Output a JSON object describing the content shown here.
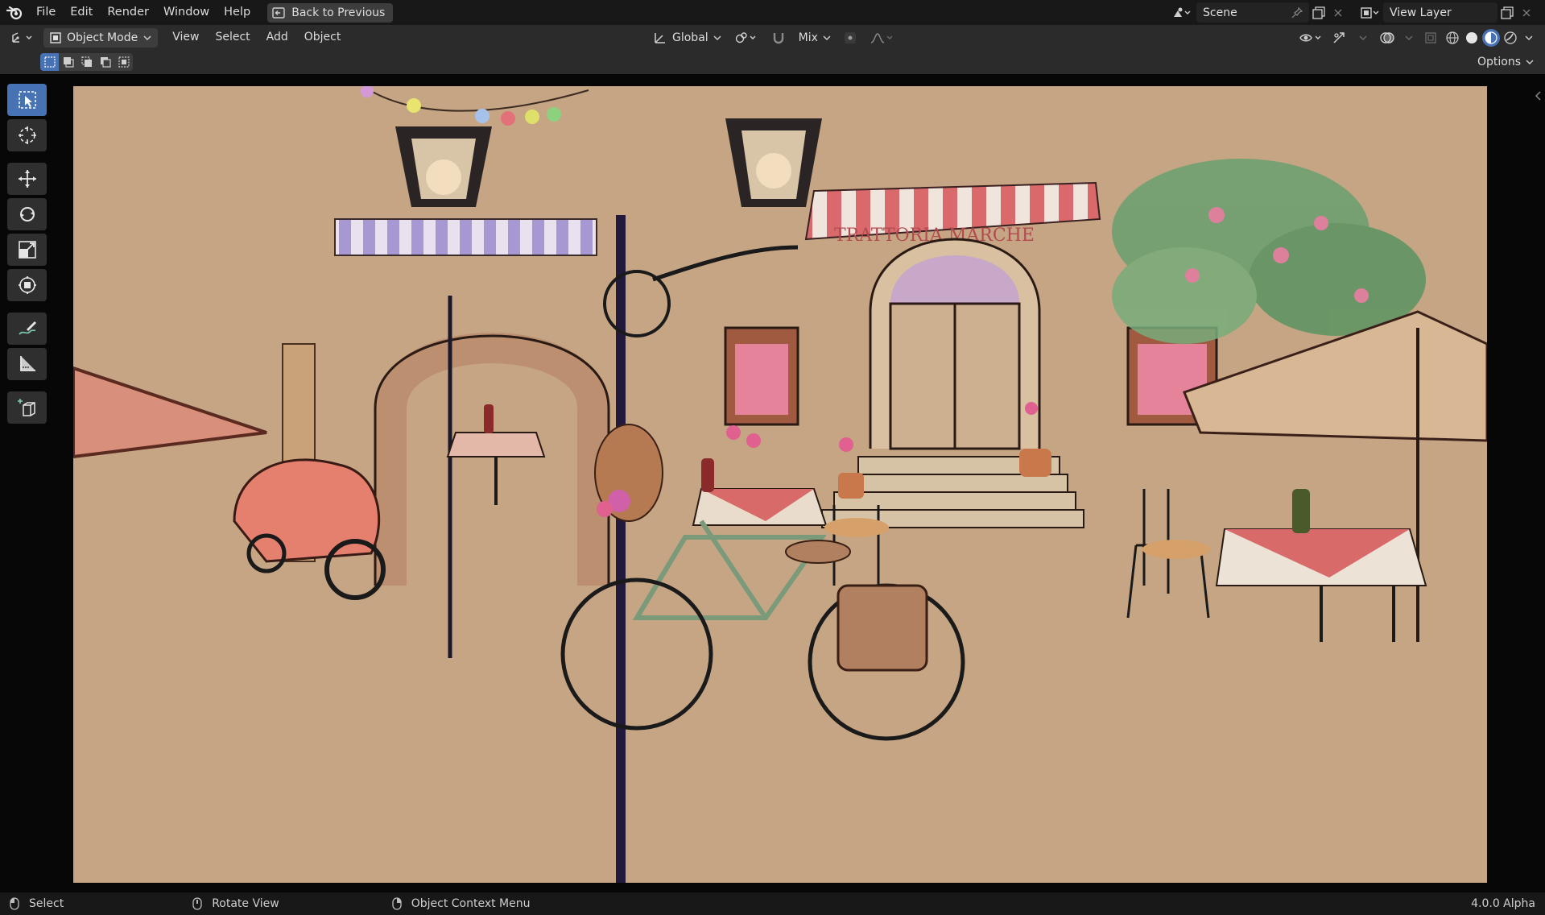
{
  "menu": {
    "items": [
      "File",
      "Edit",
      "Render",
      "Window",
      "Help"
    ],
    "back_button": "Back to Previous"
  },
  "scene": {
    "label": "Scene"
  },
  "view_layer": {
    "label": "View Layer"
  },
  "header": {
    "mode": "Object Mode",
    "items": [
      "View",
      "Select",
      "Add",
      "Object"
    ],
    "transform_orientation": "Global",
    "proportional_mode": "Mix"
  },
  "tool_settings": {
    "options_label": "Options"
  },
  "status_bar": {
    "select": "Select",
    "rotate_view": "Rotate View",
    "context_menu": "Object Context Menu",
    "version": "4.0.0 Alpha"
  },
  "colors": {
    "accent": "#4772b3",
    "paper": "#c9a987",
    "topbar": "#181818",
    "header": "#2b2b2b"
  },
  "icons": {
    "toolbar": [
      "select-box-icon",
      "cursor-icon",
      "move-icon",
      "rotate-icon",
      "scale-icon",
      "transform-icon",
      "annotate-icon",
      "measure-icon",
      "add-cube-icon"
    ]
  }
}
